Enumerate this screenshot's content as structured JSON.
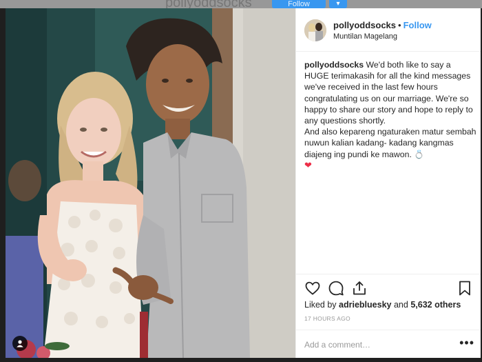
{
  "background": {
    "username": "pollyoddsocks",
    "follow_label": "Follow",
    "dropdown_glyph": "▾"
  },
  "post": {
    "username": "pollyoddsocks",
    "follow_label": "Follow",
    "location": "Muntilan Magelang",
    "caption_username": "pollyoddsocks",
    "caption_text": "We'd both like to say a HUGE terimakasih for all the kind messages we've received in the last few hours congratulating us on our marriage. We're so happy to share our story and hope to reply to any questions shortly.",
    "caption_text_2": "And also kepareng ngaturaken matur sembah nuwun kalian kadang- kadang kangmas diajeng ing pundi ke mawon.",
    "ring_emoji": "💍",
    "heart_emoji": "❤",
    "likes_prefix": "Liked by",
    "likes_user": "adriebluesky",
    "likes_and": "and",
    "likes_count": "5,632 others",
    "timestamp": "17 HOURS AGO",
    "comment_placeholder": "Add a comment…",
    "more_glyph": "•••"
  },
  "icons": {
    "like": "heart-outline-icon",
    "comment": "comment-bubble-icon",
    "share": "share-upload-icon",
    "save": "bookmark-icon",
    "tag": "person-tag-icon"
  },
  "colors": {
    "link_blue": "#3897f0",
    "text": "#262626",
    "muted": "#999999",
    "divider": "#efefef"
  }
}
